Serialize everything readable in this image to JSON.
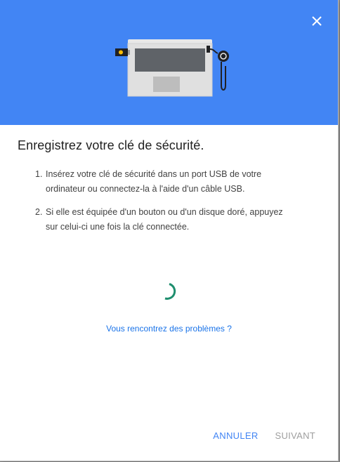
{
  "dialog": {
    "title": "Enregistrez votre clé de sécurité.",
    "steps": [
      {
        "number": "1.",
        "text": "Insérez votre clé de sécurité dans un port USB de votre ordinateur ou connectez-la à l'aide d'un câble USB."
      },
      {
        "number": "2.",
        "text": "Si elle est équipée d'un bouton ou d'un disque doré, appuyez sur celui-ci une fois la clé connectée."
      }
    ],
    "help_link": "Vous rencontrez des problèmes ?",
    "buttons": {
      "cancel": "ANNULER",
      "next": "SUIVANT"
    }
  },
  "icons": {
    "close": "close-icon",
    "illustration": "laptop-security-key-illustration",
    "spinner": "loading-spinner"
  },
  "colors": {
    "hero_background": "#4285f4",
    "primary_button": "#4285f4",
    "disabled_button": "#9e9e9e",
    "link": "#1a73e8",
    "spinner": "#1e8e6e"
  }
}
